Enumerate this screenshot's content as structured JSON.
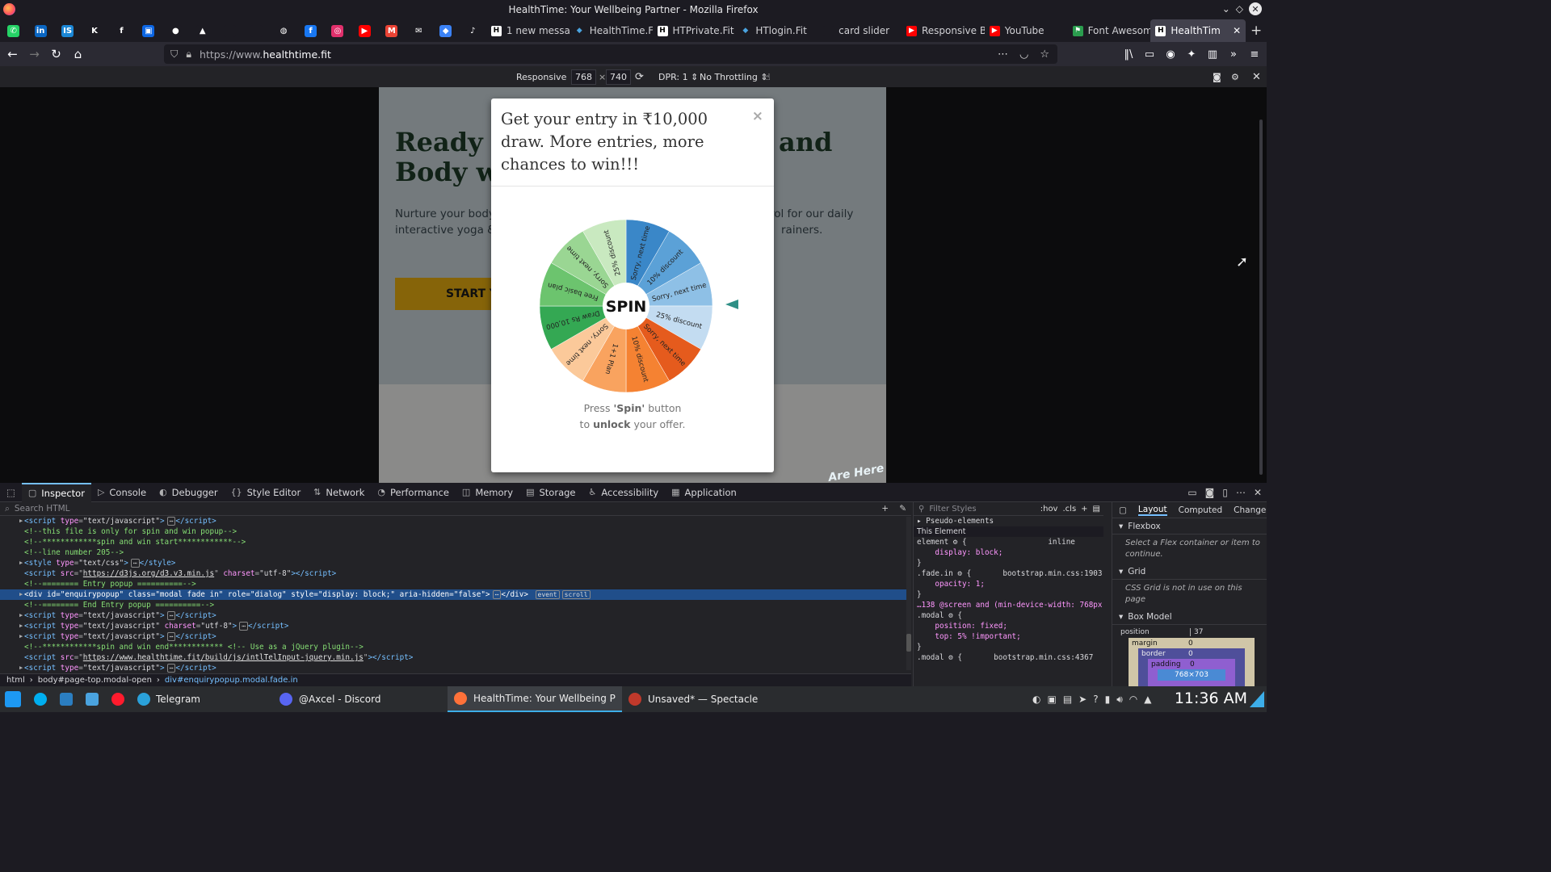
{
  "window": {
    "title": "HealthTime: Your Wellbeing Partner - Mozilla Firefox"
  },
  "pinned_tabs": [
    {
      "name": "whatsapp",
      "color": "#25d366",
      "glyph": "✆"
    },
    {
      "name": "linkedin",
      "color": "#0a66c2",
      "glyph": "in"
    },
    {
      "name": "tab-is",
      "color": "#1b87d6",
      "glyph": "IS"
    },
    {
      "name": "k-app",
      "color": "#1c1b22",
      "glyph": "K"
    },
    {
      "name": "f-app",
      "color": "#1c1b22",
      "glyph": "f"
    },
    {
      "name": "trello",
      "color": "#0c66e4",
      "glyph": "▣"
    },
    {
      "name": "github",
      "color": "#1c1b22",
      "glyph": "●"
    },
    {
      "name": "drive",
      "color": "#1c1b22",
      "glyph": "▲"
    },
    {
      "name": "blank-1",
      "color": "#1c1b22",
      "glyph": ""
    },
    {
      "name": "blank-2",
      "color": "#1c1b22",
      "glyph": ""
    },
    {
      "name": "globe",
      "color": "#1c1b22",
      "glyph": "◍"
    },
    {
      "name": "facebook",
      "color": "#1877f2",
      "glyph": "f"
    },
    {
      "name": "instagram",
      "color": "#e1306c",
      "glyph": "◎"
    },
    {
      "name": "youtube-pin",
      "color": "#ff0000",
      "glyph": "▶"
    },
    {
      "name": "gmail",
      "color": "#ea4335",
      "glyph": "M"
    },
    {
      "name": "mail",
      "color": "#1c1b22",
      "glyph": "✉"
    },
    {
      "name": "diamond",
      "color": "#3b82f6",
      "glyph": "◆"
    },
    {
      "name": "tiktok",
      "color": "#1c1b22",
      "glyph": "♪"
    }
  ],
  "tabs": [
    {
      "label": "1 new messa",
      "fav": "H",
      "favcolor": "#ffffff",
      "favtext": "#000"
    },
    {
      "label": "HealthTime.F",
      "fav": "◆",
      "favcolor": "#1c1b22",
      "favtext": "#4aa3df"
    },
    {
      "label": "HTPrivate.Fit",
      "fav": "H",
      "favcolor": "#ffffff",
      "favtext": "#000"
    },
    {
      "label": "HTlogin.Fit",
      "fav": "◆",
      "favcolor": "#1c1b22",
      "favtext": "#4aa3df"
    },
    {
      "label": "card slider",
      "fav": "",
      "favcolor": "#1c1b22",
      "favtext": "#fff"
    },
    {
      "label": "Responsive B",
      "fav": "▶",
      "favcolor": "#ff0000",
      "favtext": "#fff"
    },
    {
      "label": "YouTube",
      "fav": "▶",
      "favcolor": "#ff0000",
      "favtext": "#fff"
    },
    {
      "label": "Font Awesom",
      "fav": "⚑",
      "favcolor": "#2a9d4e",
      "favtext": "#fff"
    }
  ],
  "active_tab": {
    "label": "HealthTim",
    "fav": "H"
  },
  "url": {
    "prefix": "https://www.",
    "domain": "healthtime.fit"
  },
  "rdm": {
    "device": "Responsive",
    "width": "768",
    "height": "740",
    "dpr": "DPR: 1",
    "throttle": "No Throttling"
  },
  "page": {
    "headline_1": "Ready to",
    "headline_1b": "and",
    "headline_2": "Body wi",
    "subtext_1": "Nurture your body",
    "subtext_1b": "rol for our daily",
    "subtext_2": "interactive yoga &",
    "subtext_2b": "rainers.",
    "start_btn": "START Y",
    "are_here": "Are Here"
  },
  "modal": {
    "title": "Get your entry in ₹10,000 draw. More entries, more chances to win!!!",
    "close": "×",
    "spin": "SPIN",
    "press_1": "Press ",
    "press_spin": "'Spin'",
    "press_2": " button",
    "press_3": "to ",
    "press_unlock": "unlock",
    "press_4": " your offer."
  },
  "wheel": {
    "segments": [
      {
        "label": "Sorry, next time",
        "color": "#3a87c8"
      },
      {
        "label": "10% discount",
        "color": "#5ba1d7"
      },
      {
        "label": "Sorry, next time",
        "color": "#8ec0e6"
      },
      {
        "label": "25% discount",
        "color": "#c3dcf1"
      },
      {
        "label": "Sorry, next time",
        "color": "#e55b1d"
      },
      {
        "label": "10% discount",
        "color": "#f58232"
      },
      {
        "label": "1+1 Plan",
        "color": "#f9a35f"
      },
      {
        "label": "Sorry, next time",
        "color": "#fbc99a"
      },
      {
        "label": "Draw Rs 10,000",
        "color": "#34a853"
      },
      {
        "label": "Free basic plan",
        "color": "#6cc46e"
      },
      {
        "label": "Sorry, next time",
        "color": "#9ad693"
      },
      {
        "label": "25% discount",
        "color": "#c9e9c0"
      }
    ]
  },
  "devtools": {
    "tabs": [
      {
        "label": "Inspector",
        "icon": "▢"
      },
      {
        "label": "Console",
        "icon": "▷"
      },
      {
        "label": "Debugger",
        "icon": "◐"
      },
      {
        "label": "Style Editor",
        "icon": "{}"
      },
      {
        "label": "Network",
        "icon": "⇅"
      },
      {
        "label": "Performance",
        "icon": "◔"
      },
      {
        "label": "Memory",
        "icon": "◫"
      },
      {
        "label": "Storage",
        "icon": "▤"
      },
      {
        "label": "Accessibility",
        "icon": "♿"
      },
      {
        "label": "Application",
        "icon": "▦"
      }
    ],
    "search_placeholder": "Search HTML",
    "markup": [
      {
        "html": "<span class=\"c-tag\">&lt;script</span> <span class=\"c-attr\">type</span>=<span class=\"c-val\">\"text/javascript\"</span><span class=\"c-tag\">&gt;</span><span class=\"badge\">⋯</span><span class=\"c-tag\">&lt;/script&gt;</span>",
        "tri": "▶",
        "sel": false
      },
      {
        "html": "<span class=\"c-com\">&lt;!--this file is only for spin and win popup--&gt;</span>",
        "tri": "",
        "sel": false
      },
      {
        "html": "<span class=\"c-com\">&lt;!--************spin and win start************--&gt;</span>",
        "tri": "",
        "sel": false
      },
      {
        "html": "<span class=\"c-com\">&lt;!--line number 205--&gt;</span>",
        "tri": "",
        "sel": false
      },
      {
        "html": "<span class=\"c-tag\">&lt;style</span> <span class=\"c-attr\">type</span>=<span class=\"c-val\">\"text/css\"</span><span class=\"c-tag\">&gt;</span><span class=\"badge\">⋯</span><span class=\"c-tag\">&lt;/style&gt;</span>",
        "tri": "▶",
        "sel": false
      },
      {
        "html": "<span class=\"c-tag\">&lt;script</span> <span class=\"c-attr\">src</span>=\"<span class=\"c-link\">https://d3js.org/d3.v3.min.js</span>\" <span class=\"c-attr\">charset</span>=<span class=\"c-val\">\"utf-8\"</span><span class=\"c-tag\">&gt;&lt;/script&gt;</span>",
        "tri": "",
        "sel": false
      },
      {
        "html": "<span class=\"c-com\">&lt;!--======== Entry popup ==========--&gt;</span>",
        "tri": "",
        "sel": false
      },
      {
        "html": "&lt;div id=\"enquirypopup\" class=\"modal fade in\" role=\"dialog\" style=\"display: block;\" aria-hidden=\"false\"&gt;<span class=\"badge\">⋯</span>&lt;/div&gt; <span class=\"badge\">event</span><span class=\"badge\">scroll</span>",
        "tri": "▶",
        "sel": true
      },
      {
        "html": "<span class=\"c-com\">&lt;!--======== End Entry popup ==========--&gt;</span>",
        "tri": "",
        "sel": false
      },
      {
        "html": "<span class=\"c-tag\">&lt;script</span> <span class=\"c-attr\">type</span>=<span class=\"c-val\">\"text/javascript\"</span><span class=\"c-tag\">&gt;</span><span class=\"badge\">⋯</span><span class=\"c-tag\">&lt;/script&gt;</span>",
        "tri": "▶",
        "sel": false
      },
      {
        "html": "<span class=\"c-tag\">&lt;script</span> <span class=\"c-attr\">type</span>=<span class=\"c-val\">\"text/javascript\"</span> <span class=\"c-attr\">charset</span>=<span class=\"c-val\">\"utf-8\"</span><span class=\"c-tag\">&gt;</span><span class=\"badge\">⋯</span><span class=\"c-tag\">&lt;/script&gt;</span>",
        "tri": "▶",
        "sel": false
      },
      {
        "html": "<span class=\"c-tag\">&lt;script</span> <span class=\"c-attr\">type</span>=<span class=\"c-val\">\"text/javascript\"</span><span class=\"c-tag\">&gt;</span><span class=\"badge\">⋯</span><span class=\"c-tag\">&lt;/script&gt;</span>",
        "tri": "▶",
        "sel": false
      },
      {
        "html": "<span class=\"c-com\">&lt;!--************spin and win end************ &lt;!-- Use as a jQuery plugin--&gt;</span>",
        "tri": "",
        "sel": false
      },
      {
        "html": "<span class=\"c-tag\">&lt;script</span> <span class=\"c-attr\">src</span>=\"<span class=\"c-link\">https://www.healthtime.fit/build/js/intlTelInput-jquery.min.js</span>\"<span class=\"c-tag\">&gt;&lt;/script&gt;</span>",
        "tri": "",
        "sel": false
      },
      {
        "html": "<span class=\"c-tag\">&lt;script</span> <span class=\"c-attr\">type</span>=<span class=\"c-val\">\"text/javascript\"</span><span class=\"c-tag\">&gt;</span><span class=\"badge\">⋯</span><span class=\"c-tag\">&lt;/script&gt;</span>",
        "tri": "▶",
        "sel": false
      }
    ],
    "breadcrumbs": [
      "html",
      "body#page-top.modal-open",
      "div#enquirypopup.modal.fade.in"
    ],
    "rules_filter": "Filter Styles",
    "rules_hov": ":hov",
    "rules_cls": ".cls",
    "rules": [
      "▸ Pseudo-elements",
      "This Element",
      "element ⚙ {                  inline",
      "    display: block;",
      "}",
      ".fade.in ⚙ {       bootstrap.min.css:1903",
      "    opacity: 1;",
      "}",
      "…138 @screen and (min-device-width: 768px)",
      ".modal ⚙ {",
      "    position: fixed;",
      "    top: 5% !important;",
      "}",
      ".modal ⚙ {       bootstrap.min.css:4367"
    ],
    "layout_tabs": [
      "Layout",
      "Computed",
      "Change"
    ],
    "flexbox": "Flexbox",
    "flexbox_hint": "Select a Flex container or item to continue.",
    "grid": "Grid",
    "grid_hint": "CSS Grid is not in use on this page",
    "boxmodel": "Box Model",
    "position_label": "position",
    "position_val": "37",
    "margin": "margin",
    "border": "border",
    "padding": "padding",
    "size": "768×703",
    "zero": "0"
  },
  "taskbar": {
    "apps": [
      {
        "name": "telegram",
        "label": "Telegram",
        "color": "#2aa1da"
      }
    ],
    "tasks": [
      {
        "label": "@Axcel - Discord",
        "color": "#5865f2",
        "active": false
      },
      {
        "label": "HealthTime: Your Wellbeing Partn...",
        "color": "#ff7139",
        "active": true
      },
      {
        "label": "Unsaved* — Spectacle",
        "color": "#c0392b",
        "active": false
      }
    ],
    "clock": "11:36 AM"
  }
}
